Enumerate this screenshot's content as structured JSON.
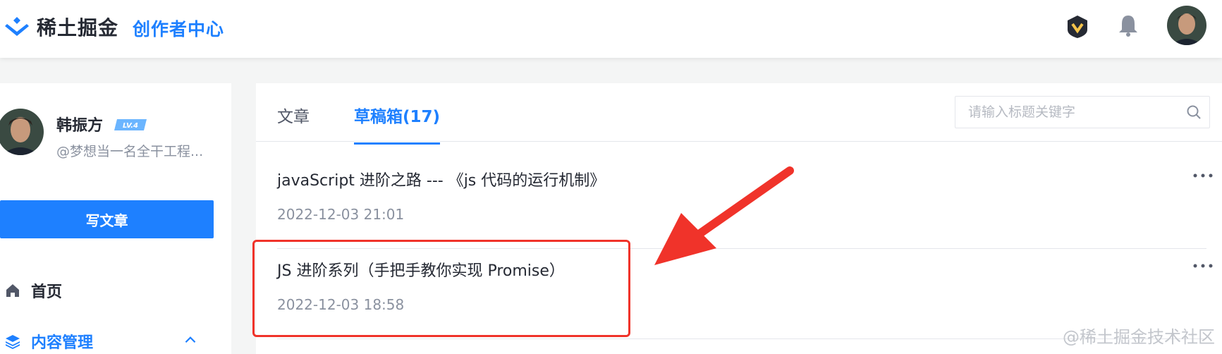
{
  "header": {
    "logo_text": "稀土掘金",
    "creator_center": "创作者中心"
  },
  "sidebar": {
    "user_name": "韩振方",
    "level_badge": "LV.4",
    "user_desc": "@梦想当一名全干工程...",
    "write_button": "写文章",
    "nav": [
      {
        "label": "首页",
        "icon": "home-icon"
      },
      {
        "label": "内容管理",
        "icon": "layers-icon",
        "expanded": true
      }
    ]
  },
  "main": {
    "tabs": [
      {
        "label": "文章",
        "active": false
      },
      {
        "label": "草稿箱(17)",
        "active": true
      }
    ],
    "search": {
      "placeholder": "请输入标题关键字"
    },
    "drafts": [
      {
        "title": "javaScript 进阶之路 --- 《js 代码的运行机制》",
        "time": "2022-12-03 21:01"
      },
      {
        "title": "JS 进阶系列（手把手教你实现 Promise）",
        "time": "2022-12-03 18:58",
        "highlighted": true
      }
    ]
  },
  "watermark": "@稀土掘金技术社区",
  "colors": {
    "accent": "#1e80ff",
    "highlight": "#f0332a",
    "text": "#252933",
    "muted": "#8a919f"
  }
}
